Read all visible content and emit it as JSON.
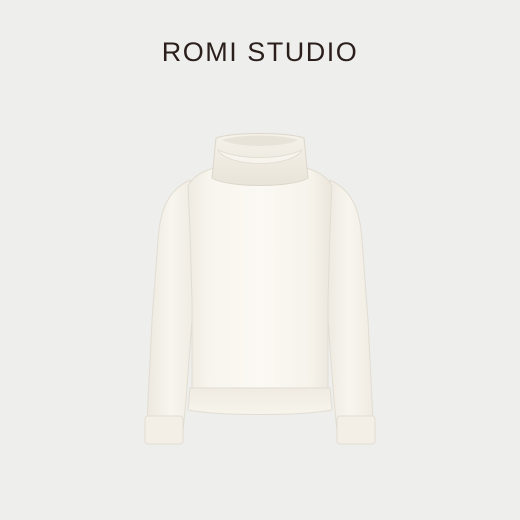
{
  "brand": {
    "name": "ROMI STUDIO",
    "color": "#2b1f1c"
  },
  "product": {
    "image_subject": "sweater-icon",
    "colors": {
      "background": "#eeeeec",
      "garment": "#faf7f0"
    }
  }
}
